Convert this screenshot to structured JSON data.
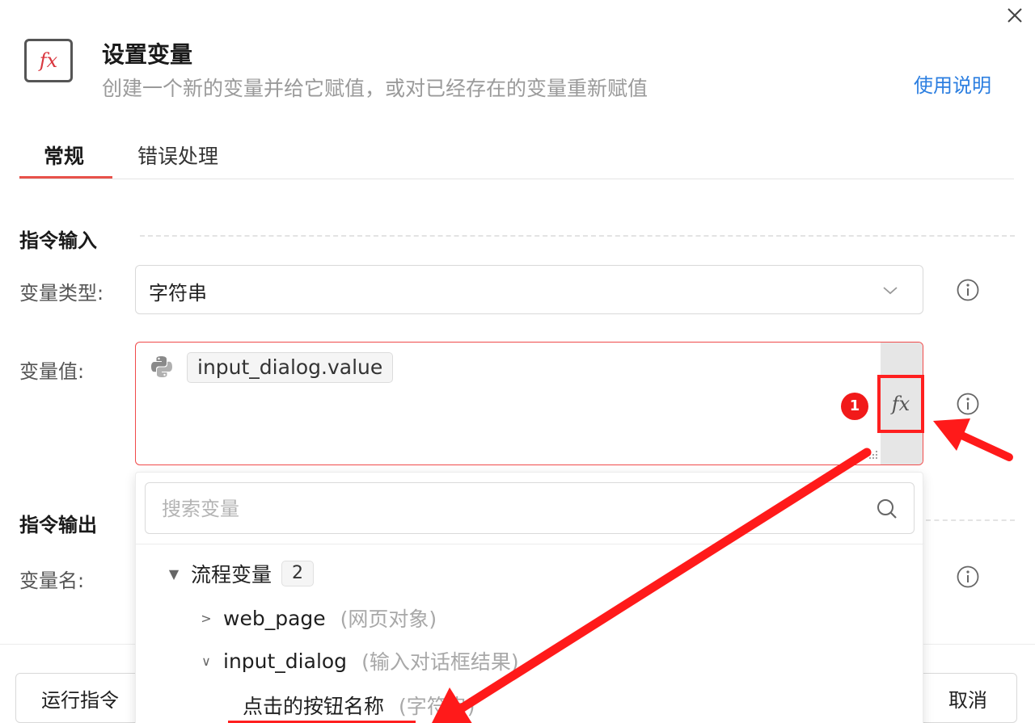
{
  "dialog": {
    "title": "设置变量",
    "subtitle": "创建一个新的变量并给它赋值，或对已经存在的变量重新赋值",
    "help_link": "使用说明",
    "icon_label": "fx"
  },
  "tabs": [
    {
      "label": "常规",
      "active": true
    },
    {
      "label": "错误处理",
      "active": false
    }
  ],
  "sections": {
    "input_title": "指令输入",
    "output_title": "指令输出"
  },
  "fields": {
    "variable_type": {
      "label": "变量类型:",
      "value": "字符串"
    },
    "variable_value": {
      "label": "变量值:",
      "value": "input_dialog.value"
    },
    "variable_name": {
      "label": "变量名:"
    }
  },
  "fx_button": {
    "label": "fx",
    "step_number": "1"
  },
  "dropdown": {
    "search_placeholder": "搜索变量",
    "group": {
      "label": "流程变量",
      "count": "2"
    },
    "items": [
      {
        "name": "web_page",
        "type": "(网页对象)"
      },
      {
        "name": "input_dialog",
        "type": "(输入对话框结果)"
      }
    ],
    "child": {
      "name": "点击的按钮名称",
      "type": "(字符串)"
    }
  },
  "footer": {
    "run_button": "运行指令",
    "cancel_button": "取消"
  },
  "colors": {
    "accent_red": "#e8524a",
    "annotation_red": "#ff1f1f",
    "link_blue": "#2b7ee0"
  }
}
